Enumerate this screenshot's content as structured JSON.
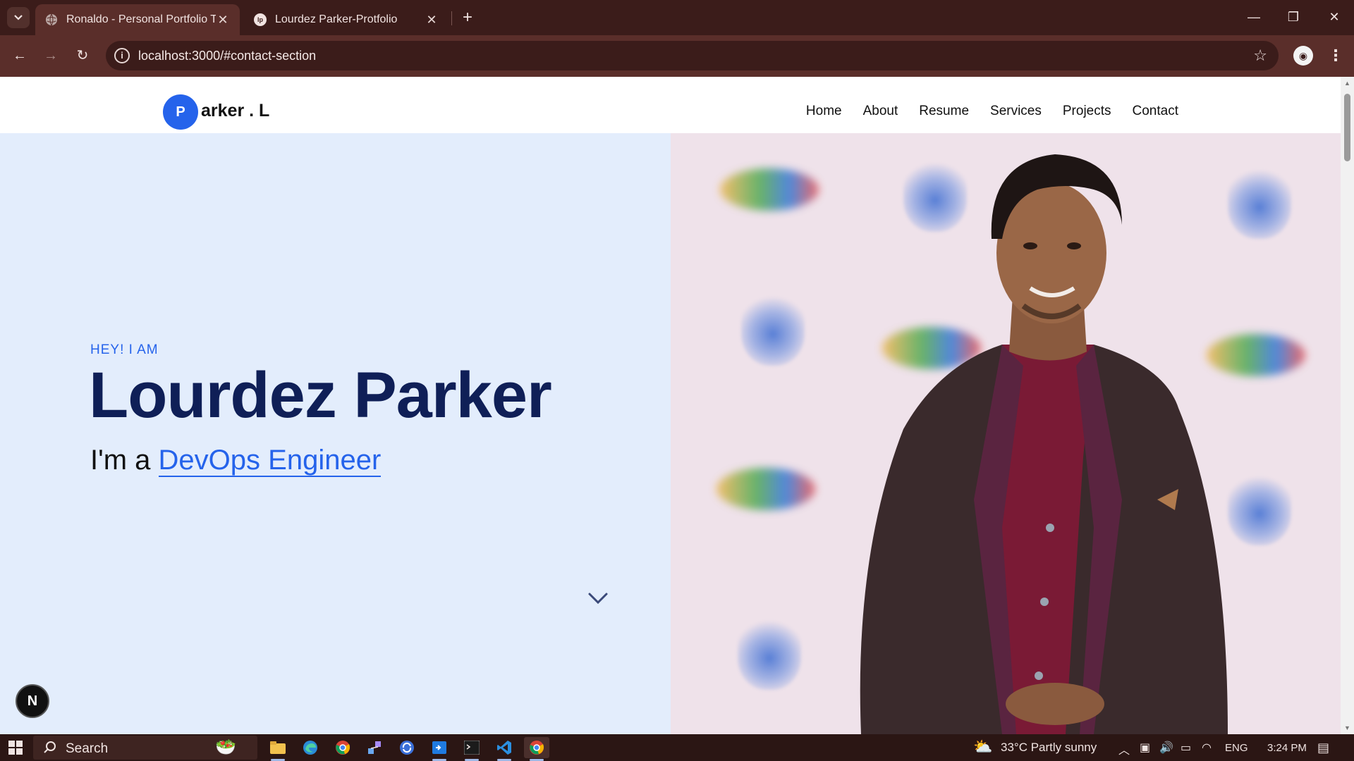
{
  "browser": {
    "tabs": [
      {
        "title": "Ronaldo - Personal Portfolio Ter",
        "active": true,
        "favicon": "globe-icon"
      },
      {
        "title": "Lourdez Parker-Protfolio",
        "active": false,
        "favicon": "lp-logo-icon"
      }
    ],
    "url": "localhost:3000/#contact-section"
  },
  "site": {
    "logo_letter": "P",
    "logo_text": "arker . L",
    "nav": [
      "Home",
      "About",
      "Resume",
      "Services",
      "Projects",
      "Contact"
    ],
    "hero": {
      "eyebrow": "HEY! I AM",
      "name": "Lourdez Parker",
      "role_prefix": "I'm a ",
      "role_typed": "DevOps Engineer"
    },
    "dev_badge": "N",
    "colors": {
      "accent": "#2563eb",
      "heading": "#0f1f57",
      "hero_bg": "#e3edfc"
    }
  },
  "taskbar": {
    "search_label": "Search",
    "weather": "33°C  Partly sunny",
    "language": "ENG",
    "time": "3:24 PM"
  }
}
